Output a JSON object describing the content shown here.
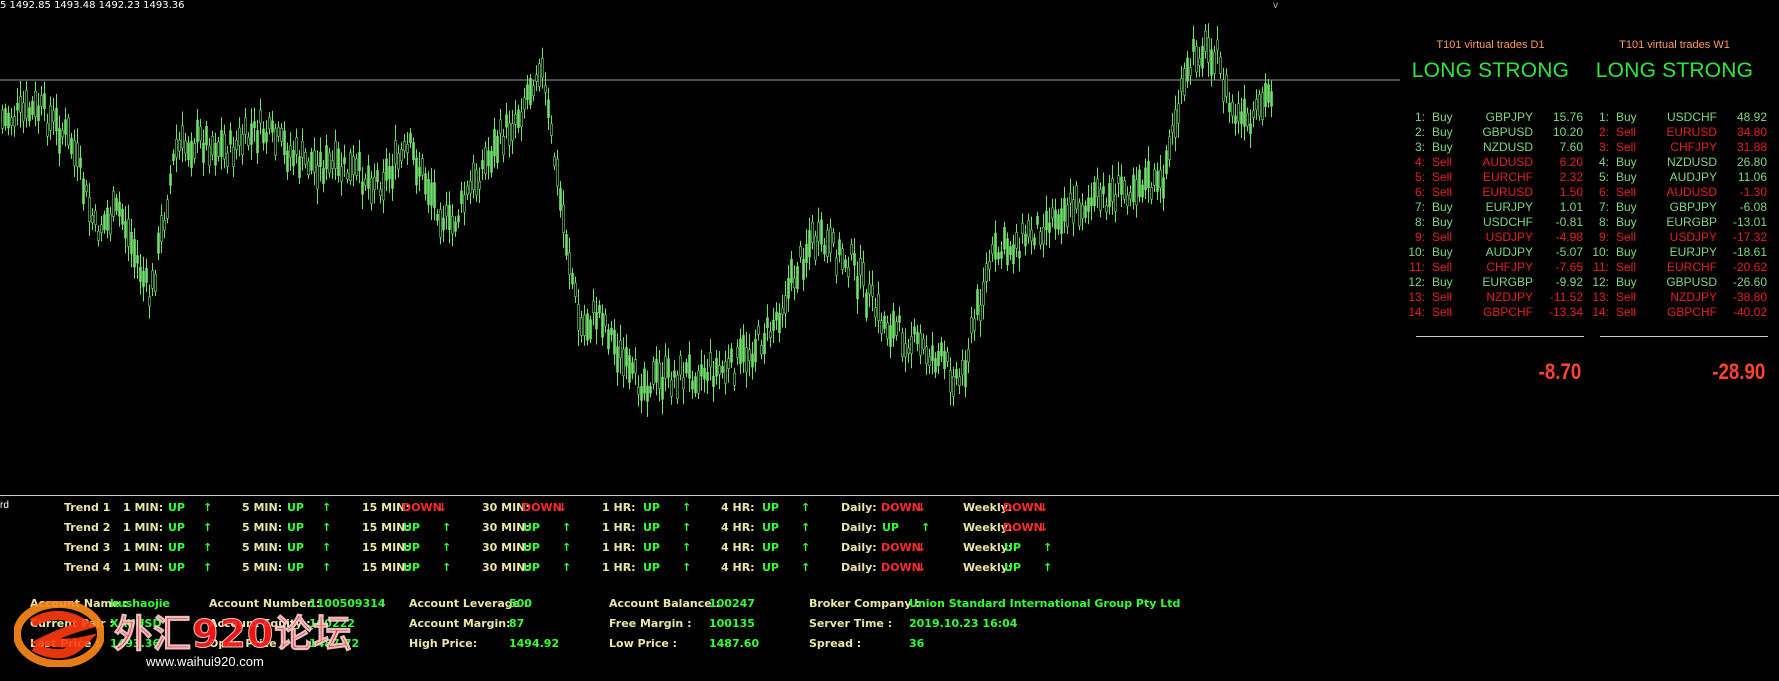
{
  "chart": {
    "ohlc_readout": "5  1492.85 1493.48 1492.23 1493.36",
    "cursor_mark": "v",
    "indicator_label": "rd",
    "colors": {
      "background": "#000000",
      "candles": "#6fe06a",
      "level_line": "#9a9a9a"
    }
  },
  "panels": [
    {
      "title": "T101 virtual trades D1",
      "signal": "LONG STRONG",
      "total": "-8.70",
      "trades": [
        {
          "idx": "1:",
          "side": "Buy",
          "symbol": "GBPJPY",
          "value": "15.76"
        },
        {
          "idx": "2:",
          "side": "Buy",
          "symbol": "GBPUSD",
          "value": "10.20"
        },
        {
          "idx": "3:",
          "side": "Buy",
          "symbol": "NZDUSD",
          "value": "7.60"
        },
        {
          "idx": "4:",
          "side": "Sell",
          "symbol": "AUDUSD",
          "value": "6.20"
        },
        {
          "idx": "5:",
          "side": "Sell",
          "symbol": "EURCHF",
          "value": "2.32"
        },
        {
          "idx": "6:",
          "side": "Sell",
          "symbol": "EURUSD",
          "value": "1.50"
        },
        {
          "idx": "7:",
          "side": "Buy",
          "symbol": "EURJPY",
          "value": "1.01"
        },
        {
          "idx": "8:",
          "side": "Buy",
          "symbol": "USDCHF",
          "value": "-0.81"
        },
        {
          "idx": "9:",
          "side": "Sell",
          "symbol": "USDJPY",
          "value": "-4.98"
        },
        {
          "idx": "10:",
          "side": "Buy",
          "symbol": "AUDJPY",
          "value": "-5.07"
        },
        {
          "idx": "11:",
          "side": "Sell",
          "symbol": "CHFJPY",
          "value": "-7.65"
        },
        {
          "idx": "12:",
          "side": "Buy",
          "symbol": "EURGBP",
          "value": "-9.92"
        },
        {
          "idx": "13:",
          "side": "Sell",
          "symbol": "NZDJPY",
          "value": "-11.52"
        },
        {
          "idx": "14:",
          "side": "Sell",
          "symbol": "GBPCHF",
          "value": "-13.34"
        }
      ]
    },
    {
      "title": "T101 virtual trades W1",
      "signal": "LONG STRONG",
      "total": "-28.90",
      "trades": [
        {
          "idx": "1:",
          "side": "Buy",
          "symbol": "USDCHF",
          "value": "48.92"
        },
        {
          "idx": "2:",
          "side": "Sell",
          "symbol": "EURUSD",
          "value": "34.80"
        },
        {
          "idx": "3:",
          "side": "Sell",
          "symbol": "CHFJPY",
          "value": "31.88"
        },
        {
          "idx": "4:",
          "side": "Buy",
          "symbol": "NZDUSD",
          "value": "26.80"
        },
        {
          "idx": "5:",
          "side": "Buy",
          "symbol": "AUDJPY",
          "value": "11.06"
        },
        {
          "idx": "6:",
          "side": "Sell",
          "symbol": "AUDUSD",
          "value": "-1.30"
        },
        {
          "idx": "7:",
          "side": "Buy",
          "symbol": "GBPJPY",
          "value": "-6.08"
        },
        {
          "idx": "8:",
          "side": "Buy",
          "symbol": "EURGBP",
          "value": "-13.01"
        },
        {
          "idx": "9:",
          "side": "Sell",
          "symbol": "USDJPY",
          "value": "-17.32"
        },
        {
          "idx": "10:",
          "side": "Buy",
          "symbol": "EURJPY",
          "value": "-18.61"
        },
        {
          "idx": "11:",
          "side": "Sell",
          "symbol": "EURCHF",
          "value": "-20.62"
        },
        {
          "idx": "12:",
          "side": "Buy",
          "symbol": "GBPUSD",
          "value": "-26.60"
        },
        {
          "idx": "13:",
          "side": "Sell",
          "symbol": "NZDJPY",
          "value": "-38.80"
        },
        {
          "idx": "14:",
          "side": "Sell",
          "symbol": "GBPCHF",
          "value": "-40.02"
        }
      ]
    }
  ],
  "trends": {
    "timeframes": [
      "1 MIN:",
      "5 MIN:",
      "15 MIN:",
      "30 MIN:",
      "1 HR:",
      "4 HR:",
      "Daily:",
      "Weekly:"
    ],
    "rows": [
      {
        "label": "Trend 1",
        "states": [
          "UP",
          "UP",
          "DOWN",
          "DOWN",
          "UP",
          "UP",
          "DOWN",
          "DOWN"
        ]
      },
      {
        "label": "Trend 2",
        "states": [
          "UP",
          "UP",
          "UP",
          "UP",
          "UP",
          "UP",
          "UP",
          "DOWN"
        ]
      },
      {
        "label": "Trend 3",
        "states": [
          "UP",
          "UP",
          "UP",
          "UP",
          "UP",
          "UP",
          "DOWN",
          "UP"
        ]
      },
      {
        "label": "Trend 4",
        "states": [
          "UP",
          "UP",
          "UP",
          "UP",
          "UP",
          "UP",
          "DOWN",
          "UP"
        ]
      }
    ],
    "arrows": {
      "UP": "↑",
      "DOWN": "↓"
    }
  },
  "account": {
    "name_label": "Account Name :",
    "name": "hushaojie",
    "pair_label": "Current Pair :",
    "pair": "XAUUSD",
    "price_label": "Last Price :",
    "price": "1493.36",
    "number_label": "Account Number :",
    "number": "1100509314",
    "equity_label": "Account Equity :",
    "equity": "100222",
    "open_label": "Open Price :",
    "open": "1487.72",
    "leverage_label": "Account Leverage :",
    "leverage": "500",
    "margin_label": "Account Margin:",
    "margin": "87",
    "high_label": "High Price:",
    "high": "1494.92",
    "balance_label": "Account Balance :",
    "balance": "100247",
    "free_label": "Free Margin :",
    "free": "100135",
    "low_label": "Low Price :",
    "low": "1487.60",
    "broker_label": "Broker Company :",
    "broker": "Union Standard International Group Pty Ltd",
    "time_label": "Server Time :",
    "time": "2019.10.23 16:04",
    "spread_label": "Spread :",
    "spread": "36"
  },
  "watermark": {
    "text": "外汇920论坛",
    "url": "www.waihui920.com"
  }
}
